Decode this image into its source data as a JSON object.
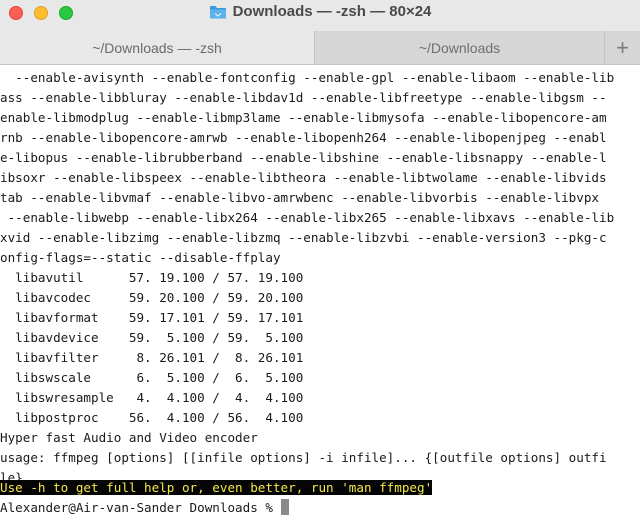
{
  "window": {
    "title": "Downloads — -zsh — 80×24"
  },
  "tabs": [
    {
      "label": "~/Downloads — -zsh"
    },
    {
      "label": "~/Downloads"
    }
  ],
  "new_tab_label": "+",
  "terminal": {
    "lines": [
      "  --enable-avisynth --enable-fontconfig --enable-gpl --enable-libaom --enable-lib",
      "ass --enable-libbluray --enable-libdav1d --enable-libfreetype --enable-libgsm --",
      "enable-libmodplug --enable-libmp3lame --enable-libmysofa --enable-libopencore-am",
      "rnb --enable-libopencore-amrwb --enable-libopenh264 --enable-libopenjpeg --enabl",
      "e-libopus --enable-librubberband --enable-libshine --enable-libsnappy --enable-l",
      "ibsoxr --enable-libspeex --enable-libtheora --enable-libtwolame --enable-libvids",
      "tab --enable-libvmaf --enable-libvo-amrwbenc --enable-libvorbis --enable-libvpx",
      " --enable-libwebp --enable-libx264 --enable-libx265 --enable-libxavs --enable-lib",
      "xvid --enable-libzimg --enable-libzmq --enable-libzvbi --enable-version3 --pkg-c",
      "onfig-flags=--static --disable-ffplay",
      "  libavutil      57. 19.100 / 57. 19.100",
      "  libavcodec     59. 20.100 / 59. 20.100",
      "  libavformat    59. 17.101 / 59. 17.101",
      "  libavdevice    59.  5.100 / 59.  5.100",
      "  libavfilter     8. 26.101 /  8. 26.101",
      "  libswscale      6.  5.100 /  6.  5.100",
      "  libswresample   4.  4.100 /  4.  4.100",
      "  libpostproc    56.  4.100 / 56.  4.100",
      "Hyper fast Audio and Video encoder",
      "usage: ffmpeg [options] [[infile options] -i infile]... {[outfile options] outfi",
      "le}...",
      ""
    ],
    "highlighted_line": "Use -h to get full help or, even better, run 'man ffmpeg'",
    "prompt": "Alexander@Air-van-Sander Downloads % "
  }
}
